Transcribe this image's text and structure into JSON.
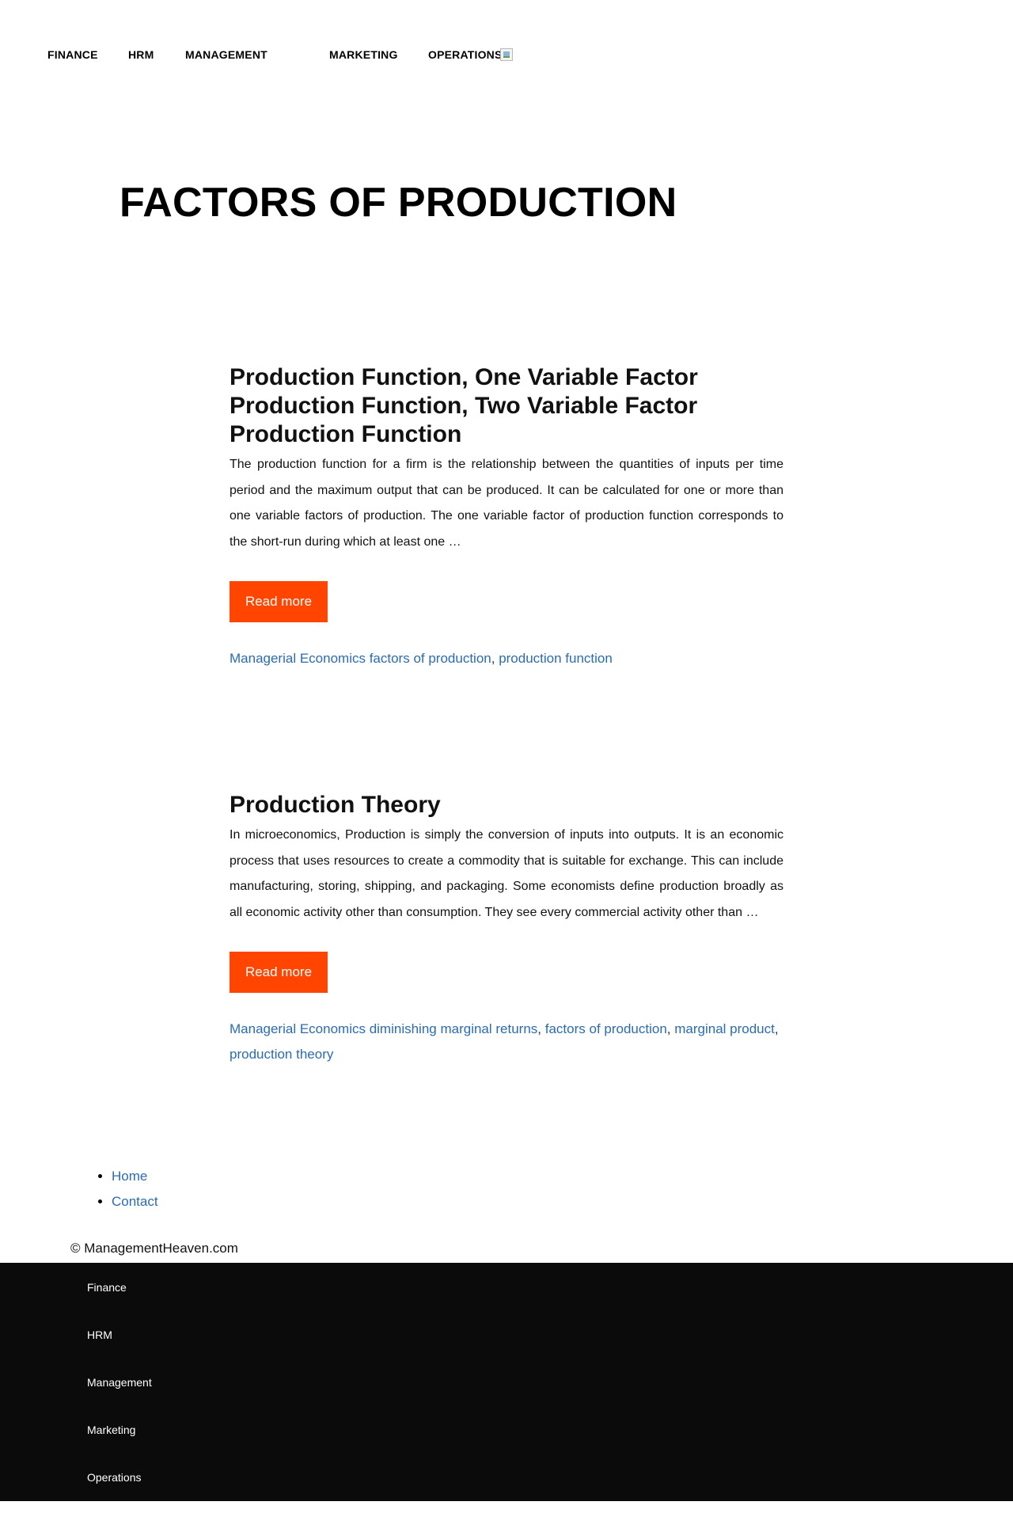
{
  "nav": {
    "items": [
      "FINANCE",
      "HRM",
      "MANAGEMENT",
      "MARKETING",
      "OPERATIONS"
    ]
  },
  "page_title": "FACTORS OF PRODUCTION",
  "articles": [
    {
      "titles": [
        "Production Function, One Variable Factor",
        "Production Function, Two Variable Factor",
        "Production Function"
      ],
      "excerpt": "The production function for a firm is the relationship between the quantities of inputs per time period and the maximum output that can be produced. It can be calculated for one or more than one variable factors of production. The one variable factor of production function corresponds to the short-run during which at least one …",
      "read_more": "Read more",
      "category": "Managerial Economics",
      "tags": [
        "factors of production",
        "production function"
      ]
    },
    {
      "titles": [
        "Production Theory"
      ],
      "excerpt": "In microeconomics, Production is simply the conversion of inputs into outputs. It is an economic process that uses resources to create a commodity that is suitable for exchange. This can include manufacturing, storing, shipping, and packaging. Some economists define production broadly as all economic activity other than consumption. They see every commercial activity other than …",
      "read_more": "Read more",
      "category": "Managerial Economics",
      "tags": [
        "diminishing marginal returns",
        "factors of production",
        "marginal product",
        "production theory"
      ]
    }
  ],
  "footer": {
    "links": [
      "Home",
      "Contact"
    ],
    "copyright": "© ManagementHeaven.com"
  },
  "bottom_menu": [
    "Finance",
    "HRM",
    "Management",
    "Marketing",
    "Operations"
  ],
  "colors": {
    "button_bg": "#ff4500",
    "link": "#2b6cb0",
    "footer_bg": "#0b0b0b"
  }
}
